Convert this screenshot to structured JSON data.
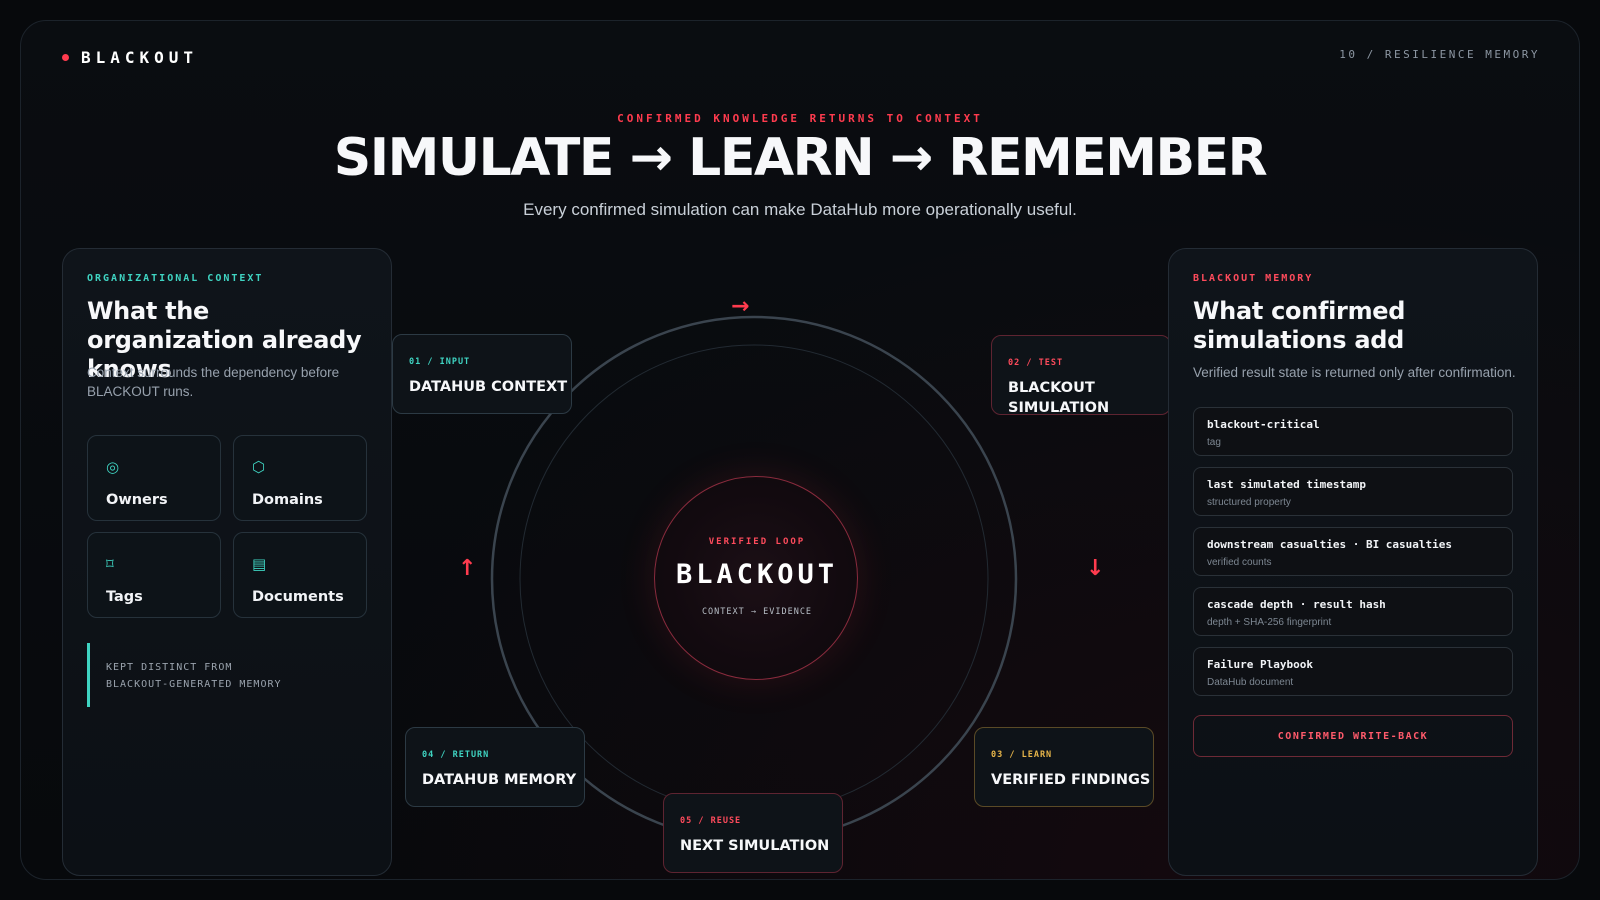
{
  "brand": {
    "name": "BLACKOUT"
  },
  "slide_label": "10 / RESILIENCE MEMORY",
  "hero": {
    "kicker": "CONFIRMED KNOWLEDGE RETURNS TO CONTEXT",
    "title": "SIMULATE → LEARN → REMEMBER",
    "subtitle": "Every confirmed simulation can make DataHub more operationally useful."
  },
  "left_panel": {
    "eyebrow": "ORGANIZATIONAL CONTEXT",
    "title": "What the organization already knows",
    "description": "Context surrounds the dependency before BLACKOUT runs.",
    "tiles": [
      {
        "label": "Owners",
        "icon": "target-icon",
        "glyph": "◎"
      },
      {
        "label": "Domains",
        "icon": "hexagon-icon",
        "glyph": "⬡"
      },
      {
        "label": "Tags",
        "icon": "tag-icon",
        "glyph": "⌑"
      },
      {
        "label": "Documents",
        "icon": "document-icon",
        "glyph": "▤"
      }
    ],
    "note_line1": "KEPT DISTINCT FROM",
    "note_line2": "BLACKOUT-GENERATED MEMORY"
  },
  "loop": {
    "center_kicker": "VERIFIED LOOP",
    "center_title": "BLACKOUT",
    "center_sub": "CONTEXT → EVIDENCE",
    "arrows": {
      "top": "→",
      "right": "↓",
      "bottom": "←",
      "left": "↑"
    },
    "nodes": [
      {
        "step": "01 / INPUT",
        "title": "DATAHUB CONTEXT"
      },
      {
        "step": "02 / TEST",
        "title": "BLACKOUT SIMULATION"
      },
      {
        "step": "03 / LEARN",
        "title": "VERIFIED FINDINGS"
      },
      {
        "step": "04 / RETURN",
        "title": "DATAHUB MEMORY"
      },
      {
        "step": "05 / REUSE",
        "title": "NEXT SIMULATION"
      }
    ]
  },
  "right_panel": {
    "eyebrow": "BLACKOUT MEMORY",
    "title": "What confirmed simulations add",
    "description": "Verified result state is returned only after confirmation.",
    "items": [
      {
        "title": "blackout-critical",
        "sub": "tag"
      },
      {
        "title": "last simulated timestamp",
        "sub": "structured property"
      },
      {
        "title": "downstream casualties · BI casualties",
        "sub": "verified counts"
      },
      {
        "title": "cascade depth · result hash",
        "sub": "depth + SHA-256 fingerprint"
      },
      {
        "title": "Failure Playbook",
        "sub": "DataHub document"
      }
    ],
    "writeback_label": "CONFIRMED WRITE-BACK"
  },
  "colors": {
    "accent_red": "#ff3b4e",
    "accent_teal": "#3fd4c2",
    "accent_gold": "#e8b64a",
    "background": "#07090c"
  }
}
